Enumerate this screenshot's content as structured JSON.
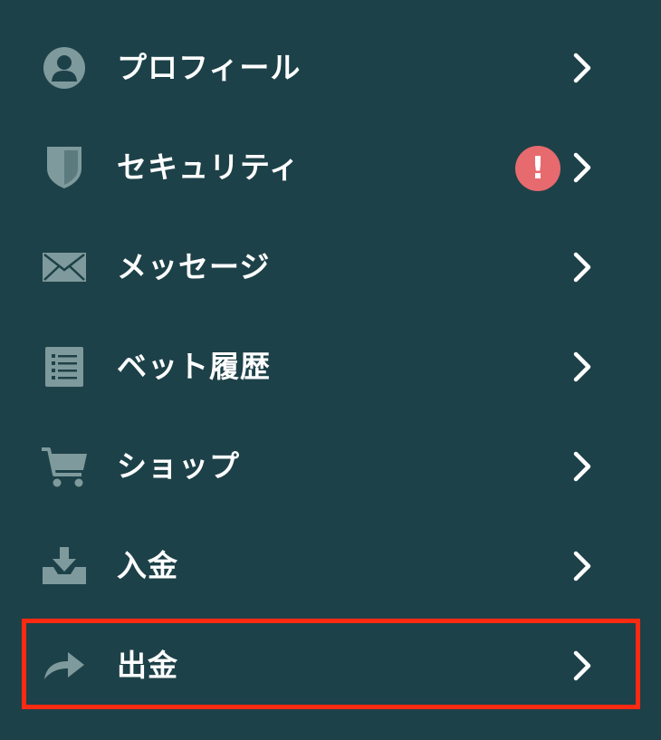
{
  "menu": {
    "items": [
      {
        "id": "profile",
        "label": "プロフィール",
        "icon": "person-icon"
      },
      {
        "id": "security",
        "label": "セキュリティ",
        "icon": "shield-icon",
        "badge": "!"
      },
      {
        "id": "messages",
        "label": "メッセージ",
        "icon": "envelope-icon"
      },
      {
        "id": "bet-history",
        "label": "ベット履歴",
        "icon": "list-icon"
      },
      {
        "id": "shop",
        "label": "ショップ",
        "icon": "cart-icon"
      },
      {
        "id": "deposit",
        "label": "入金",
        "icon": "download-tray-icon"
      },
      {
        "id": "withdraw",
        "label": "出金",
        "icon": "share-arrow-icon",
        "highlighted": true
      }
    ]
  },
  "colors": {
    "background": "#1d4148",
    "icon": "#7e9a9c",
    "text": "#ffffff",
    "alert": "#e66a6e",
    "highlight": "#fb2a12"
  }
}
